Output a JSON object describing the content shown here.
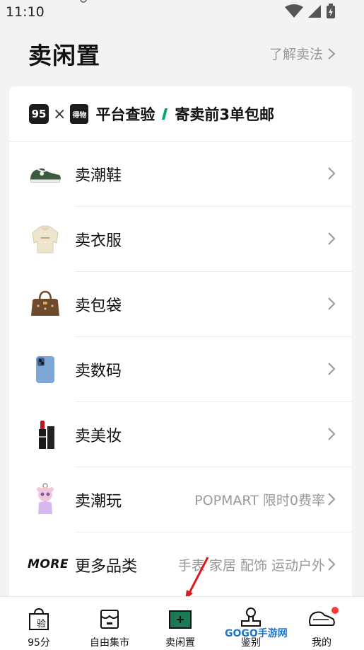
{
  "status": {
    "time": "11:10"
  },
  "header": {
    "title": "卖闲置",
    "learn": "了解卖法"
  },
  "promo": {
    "logo95": "95",
    "times": "×",
    "logo_dw": "得物",
    "text1": "平台查验",
    "text2": "寄卖前3单包邮"
  },
  "rows": [
    {
      "label": "卖潮鞋",
      "icon": "sneaker-icon"
    },
    {
      "label": "卖衣服",
      "icon": "hoodie-icon"
    },
    {
      "label": "卖包袋",
      "icon": "handbag-icon"
    },
    {
      "label": "卖数码",
      "icon": "phone-icon"
    },
    {
      "label": "卖美妆",
      "icon": "lipstick-icon"
    },
    {
      "label": "卖潮玩",
      "icon": "toy-icon",
      "sub": "POPMART 限时0费率"
    },
    {
      "label": "更多品类",
      "badge": "MORE",
      "sub": "手表 家居 配饰 运动户外"
    }
  ],
  "tabs": [
    {
      "label": "95分",
      "icon": "shopping-bag-icon",
      "icon_text": "验"
    },
    {
      "label": "自由集市",
      "icon": "market-icon"
    },
    {
      "label": "卖闲置",
      "icon": "sell-plus-icon"
    },
    {
      "label": "鉴别",
      "icon": "stamp-icon"
    },
    {
      "label": "我的",
      "icon": "profile-sneaker-icon"
    }
  ],
  "watermark": "GOGO手游网",
  "colors": {
    "accent": "#0aa56f",
    "badge": "#ff3b30",
    "muted": "#999999"
  }
}
